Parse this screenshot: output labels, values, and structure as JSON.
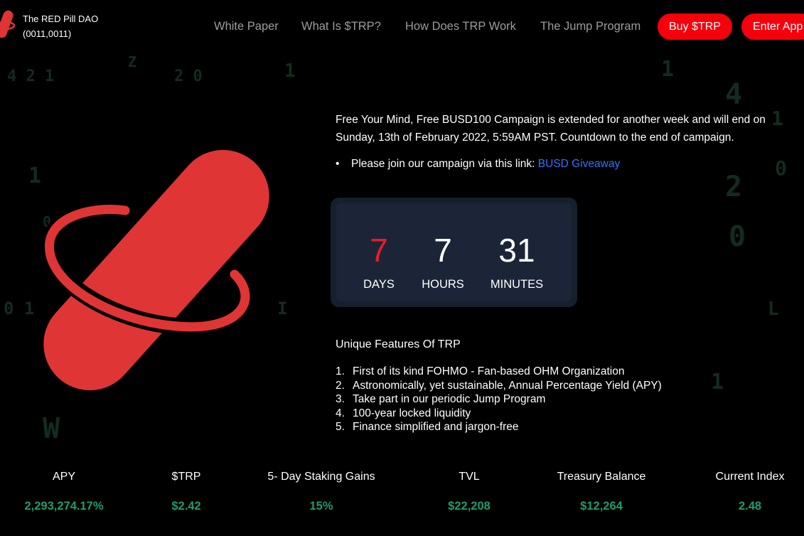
{
  "header": {
    "brand_line1": "The RED Pill DAO",
    "brand_line2": "(0011,0011)",
    "nav": [
      "White Paper",
      "What Is $TRP?",
      "How Does TRP Work",
      "The Jump Program"
    ],
    "buy_label": "Buy $TRP",
    "enter_label": "Enter App"
  },
  "campaign": {
    "intro": "Free Your Mind, Free BUSD100 Campaign is extended for another week and will end on Sunday, 13th of February 2022, 5:59AM PST. Countdown to the end of campaign.",
    "join_text": "Please join our campaign via this link: ",
    "join_link": "BUSD Giveaway"
  },
  "countdown": {
    "days": "7",
    "hours": "7",
    "minutes": "31",
    "days_label": "DAYS",
    "hours_label": "HOURS",
    "minutes_label": "MINUTES"
  },
  "features": {
    "title": "Unique Features Of TRP",
    "items": [
      "First of its kind FOHMO - Fan-based OHM Organization",
      "Astronomically, yet sustainable, Annual Percentage Yield (APY)",
      "Take part in our periodic Jump Program",
      "100-year locked liquidity",
      "Finance simplified and jargon-free"
    ]
  },
  "stats": [
    {
      "label": "APY",
      "value": "2,293,274.17%"
    },
    {
      "label": "$TRP",
      "value": "$2.42"
    },
    {
      "label": "5- Day Staking Gains",
      "value": "15%"
    },
    {
      "label": "TVL",
      "value": "$22,208"
    },
    {
      "label": "Treasury Balance",
      "value": "$12,264"
    },
    {
      "label": "Current Index",
      "value": "2.48"
    }
  ],
  "colors": {
    "accent_red": "#f5010c",
    "pill_red": "#e03535",
    "stat_green": "#1f9b6e",
    "link_blue": "#2f74ff"
  }
}
